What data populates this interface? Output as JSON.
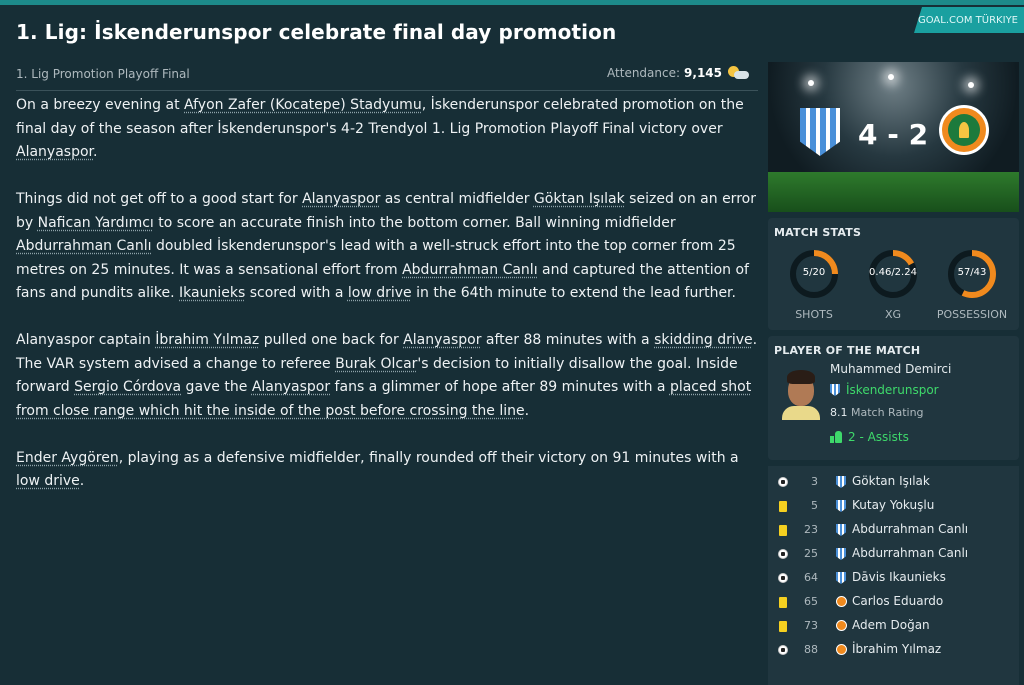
{
  "source_tag": "GOAL.COM TÜRKIYE",
  "headline": "1. Lig: İskenderunspor celebrate final day promotion",
  "competition": "1. Lig Promotion Playoff Final",
  "attendance_label": "Attendance:",
  "attendance_value": "9,145",
  "weather_icon": "partly-cloudy-icon",
  "article": {
    "p1": [
      {
        "t": "On a breezy evening at "
      },
      {
        "t": "Afyon Zafer (Kocatepe) Stadyumu",
        "link": true
      },
      {
        "t": ", İskenderunspor celebrated promotion on the final day of the season after İskenderunspor's 4-2 Trendyol 1. Lig Promotion Playoff Final victory over "
      },
      {
        "t": "Alanyaspor",
        "link": true
      },
      {
        "t": "."
      }
    ],
    "p2": [
      {
        "t": "Things did not get off to a good start for "
      },
      {
        "t": "Alanyaspor",
        "link": true
      },
      {
        "t": " as central midfielder "
      },
      {
        "t": "Göktan Işılak",
        "link": true
      },
      {
        "t": " seized on an error by "
      },
      {
        "t": "Nafican Yardımcı",
        "link": true
      },
      {
        "t": " to score an accurate finish into the bottom corner. Ball winning midfielder "
      },
      {
        "t": "Abdurrahman Canlı",
        "link": true
      },
      {
        "t": " doubled İskenderunspor's lead with a well-struck effort into the top corner from 25 metres on 25 minutes. It was a sensational effort from "
      },
      {
        "t": "Abdurrahman Canlı",
        "link": true
      },
      {
        "t": " and captured the attention of fans and pundits alike. "
      },
      {
        "t": "Ikaunieks",
        "link": true
      },
      {
        "t": " scored with a "
      },
      {
        "t": "low drive",
        "link": true
      },
      {
        "t": " in the 64th minute to extend the lead further."
      }
    ],
    "p3": [
      {
        "t": "Alanyaspor captain "
      },
      {
        "t": "İbrahim Yılmaz",
        "link": true
      },
      {
        "t": " pulled one back for "
      },
      {
        "t": "Alanyaspor",
        "link": true
      },
      {
        "t": " after 88 minutes with a "
      },
      {
        "t": "skidding drive",
        "link": true
      },
      {
        "t": ". The VAR system advised a change to referee "
      },
      {
        "t": "Burak Olcar",
        "link": true
      },
      {
        "t": "'s decision to initially disallow the goal. Inside forward "
      },
      {
        "t": "Sergio Córdova",
        "link": true
      },
      {
        "t": " gave the "
      },
      {
        "t": "Alanyaspor",
        "link": true
      },
      {
        "t": " fans a glimmer of hope after 89 minutes with a "
      },
      {
        "t": "placed shot from close range which hit the inside of the post before crossing the line",
        "link": true
      },
      {
        "t": "."
      }
    ],
    "p4": [
      {
        "t": "Ender Aygören",
        "link": true
      },
      {
        "t": ", playing as a defensive midfielder, finally rounded off their victory on 91 minutes with a "
      },
      {
        "t": "low drive",
        "link": true
      },
      {
        "t": "."
      }
    ]
  },
  "score": {
    "home": "4",
    "separator": "-",
    "away": "2"
  },
  "match_stats": {
    "title": "MATCH STATS",
    "stats": [
      {
        "label": "SHOTS",
        "value": "5/20",
        "fill": 0.25
      },
      {
        "label": "XG",
        "value": "0.46/2.24",
        "fill": 0.17
      },
      {
        "label": "POSSESSION",
        "value": "57/43",
        "fill": 0.57
      }
    ],
    "accent_color": "#f08a1e",
    "ring_bg_color": "#0d1a1f"
  },
  "potm": {
    "title": "PLAYER OF THE MATCH",
    "name": "Muhammed Demirci",
    "club": "İskenderunspor",
    "rating_value": "8.1",
    "rating_label": "Match Rating",
    "assists": "2 - Assists"
  },
  "events": [
    {
      "icon": "goal-ball-icon",
      "minute": "3",
      "team": "home",
      "player": "Göktan Işılak"
    },
    {
      "icon": "yellow-card-icon",
      "minute": "5",
      "team": "home",
      "player": "Kutay Yokuşlu"
    },
    {
      "icon": "yellow-card-icon",
      "minute": "23",
      "team": "home",
      "player": "Abdurrahman Canlı"
    },
    {
      "icon": "goal-ball-icon",
      "minute": "25",
      "team": "home",
      "player": "Abdurrahman Canlı"
    },
    {
      "icon": "goal-ball-icon",
      "minute": "64",
      "team": "home",
      "player": "Dāvis Ikaunieks"
    },
    {
      "icon": "yellow-card-icon",
      "minute": "65",
      "team": "away",
      "player": "Carlos Eduardo"
    },
    {
      "icon": "yellow-card-icon",
      "minute": "73",
      "team": "away",
      "player": "Adem Doğan"
    },
    {
      "icon": "goal-ball-icon",
      "minute": "88",
      "team": "away",
      "player": "İbrahim Yılmaz"
    }
  ]
}
